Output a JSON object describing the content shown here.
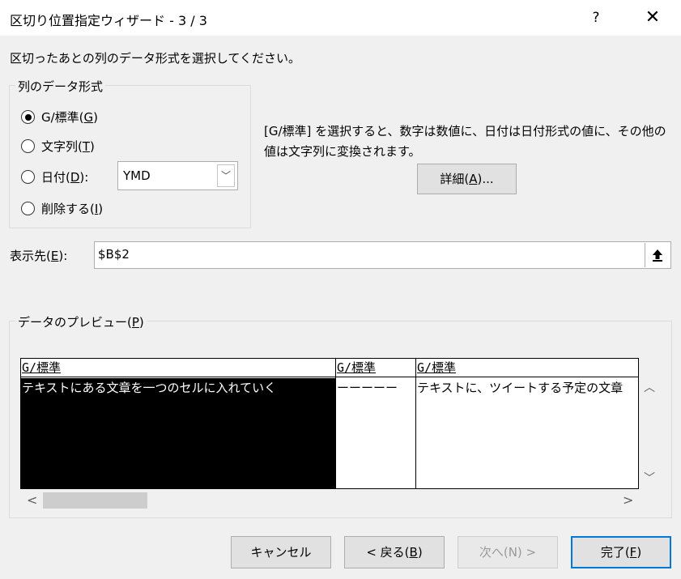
{
  "window": {
    "title": "区切り位置指定ウィザード - 3 / 3",
    "help_label": "?",
    "close_label": "✕"
  },
  "instruction": "区切ったあとの列のデータ形式を選択してください。",
  "format_group": {
    "title": "列のデータ形式",
    "options": [
      {
        "pre": "G/標準(",
        "key": "G",
        "post": ")",
        "checked": true
      },
      {
        "pre": "文字列(",
        "key": "T",
        "post": ")",
        "checked": false
      },
      {
        "pre": "日付(",
        "key": "D",
        "post": "):",
        "checked": false
      },
      {
        "pre": "削除する(",
        "key": "I",
        "post": ")",
        "checked": false
      }
    ],
    "date_select": {
      "value": "YMD",
      "arrow": "﹀"
    }
  },
  "description": "[G/標準] を選択すると、数字は数値に、日付は日付形式の値に、その他の値は文字列に変換されます。",
  "detail_button": {
    "pre": "詳細(",
    "key": "A",
    "post": ")..."
  },
  "destination": {
    "pre": "表示先(",
    "key": "E",
    "post": "):",
    "value": "$B$2",
    "collapse_icon": "collapse-dialog-icon"
  },
  "preview": {
    "title_pre": "データのプレビュー(",
    "title_key": "P",
    "title_post": ")",
    "columns": [
      {
        "header": "G/標準",
        "cell": "テキストにある文章を一つのセルに入れていく",
        "selected": true
      },
      {
        "header": "G/標準",
        "cell": "ーーーーー",
        "selected": false
      },
      {
        "header": "G/標準",
        "cell": "テキストに、ツイートする予定の文章",
        "selected": false
      }
    ],
    "scroll_up": "︿",
    "scroll_down": "﹀",
    "scroll_left": "<",
    "scroll_right": ">"
  },
  "buttons": {
    "cancel": {
      "label": "キャンセル"
    },
    "back": {
      "pre": "< 戻る(",
      "key": "B",
      "post": ")"
    },
    "next": {
      "label": "次へ(N) >",
      "disabled": true
    },
    "finish": {
      "pre": "完了(",
      "key": "F",
      "post": ")"
    }
  },
  "colors": {
    "accent": "#0078d7",
    "selected_bg": "#000000",
    "dialog_bg": "#f0f0f0"
  }
}
